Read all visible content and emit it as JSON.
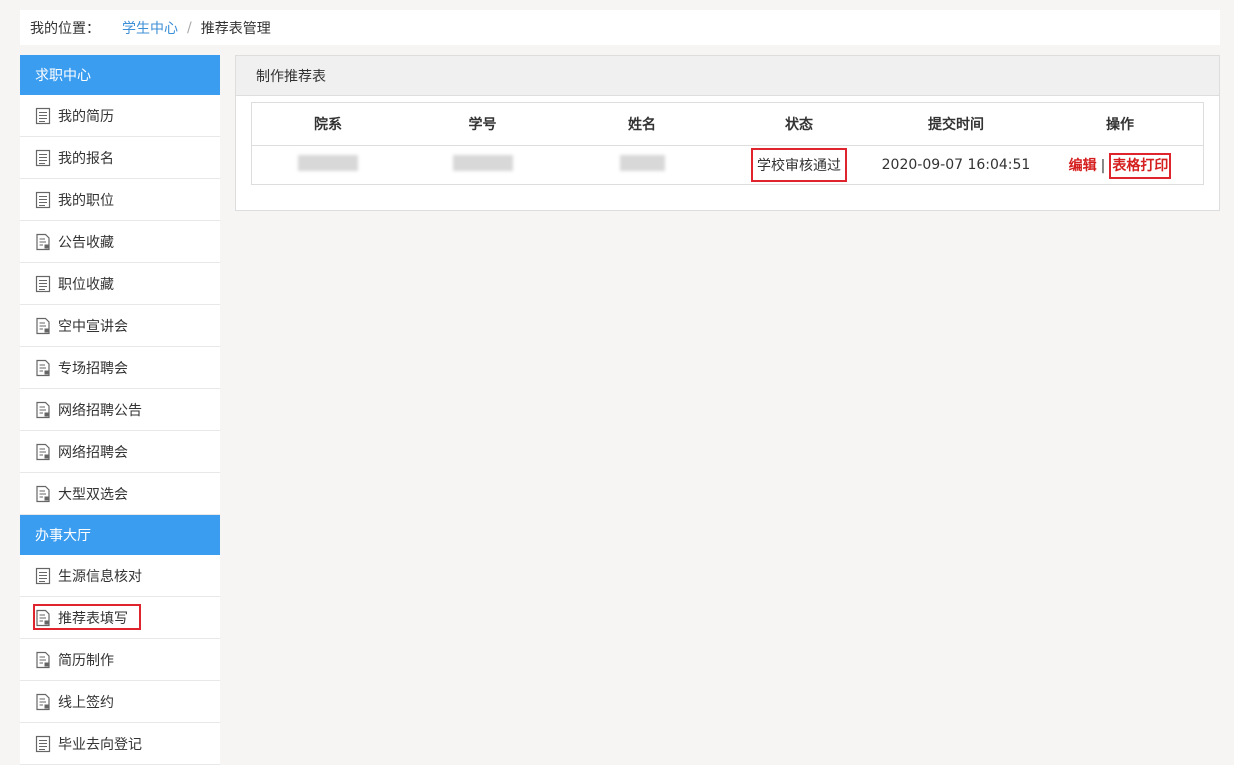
{
  "breadcrumb": {
    "label": "我的位置：",
    "link": "学生中心",
    "separator": "/",
    "current": "推荐表管理"
  },
  "sidebar": {
    "sections": [
      {
        "title": "求职中心",
        "items": [
          {
            "label": "我的简历",
            "icon": "document-icon"
          },
          {
            "label": "我的报名",
            "icon": "document-icon"
          },
          {
            "label": "我的职位",
            "icon": "document-icon"
          },
          {
            "label": "公告收藏",
            "icon": "file-icon"
          },
          {
            "label": "职位收藏",
            "icon": "document-icon"
          },
          {
            "label": "空中宣讲会",
            "icon": "file-icon"
          },
          {
            "label": "专场招聘会",
            "icon": "file-icon"
          },
          {
            "label": "网络招聘公告",
            "icon": "file-icon"
          },
          {
            "label": "网络招聘会",
            "icon": "file-icon"
          },
          {
            "label": "大型双选会",
            "icon": "file-icon"
          }
        ]
      },
      {
        "title": "办事大厅",
        "items": [
          {
            "label": "生源信息核对",
            "icon": "document-icon"
          },
          {
            "label": "推荐表填写",
            "icon": "file-icon",
            "highlighted": true
          },
          {
            "label": "简历制作",
            "icon": "file-icon"
          },
          {
            "label": "线上签约",
            "icon": "file-icon"
          },
          {
            "label": "毕业去向登记",
            "icon": "document-icon"
          }
        ]
      }
    ]
  },
  "panel": {
    "title": "制作推荐表",
    "table": {
      "headers": [
        "院系",
        "学号",
        "姓名",
        "状态",
        "提交时间",
        "操作"
      ],
      "rows": [
        {
          "status": "学校审核通过",
          "submitted": "2020-09-07 16:04:51",
          "edit_label": "编辑",
          "action_sep": "|",
          "print_label": "表格打印"
        }
      ]
    }
  },
  "colors": {
    "accent": "#3b9df0",
    "link": "#3d8fd6",
    "action": "#d51f1f",
    "highlight_border": "#e0242e"
  }
}
